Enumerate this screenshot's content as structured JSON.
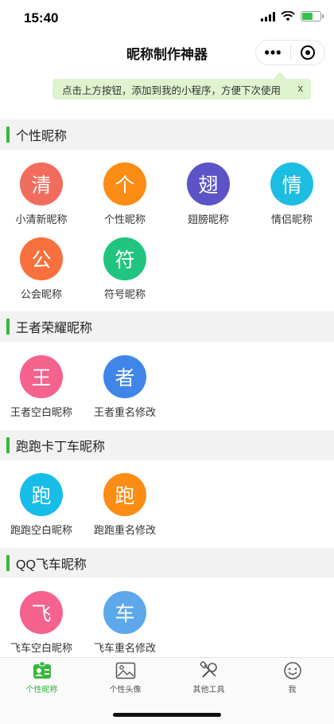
{
  "status": {
    "time": "15:40"
  },
  "nav": {
    "title": "昵称制作神器",
    "more_glyph": "•••"
  },
  "tip": {
    "text": "点击上方按钮，添加到我的小程序，方便下次使用",
    "close": "x"
  },
  "sections": [
    {
      "title": "个性昵称",
      "items": [
        {
          "glyph": "清",
          "label": "小清新昵称",
          "color": "#f26c5e"
        },
        {
          "glyph": "个",
          "label": "个性昵称",
          "color": "#fb8c14"
        },
        {
          "glyph": "翅",
          "label": "翅膀昵称",
          "color": "#5b53c6"
        },
        {
          "glyph": "情",
          "label": "情侣昵称",
          "color": "#1cbde0"
        },
        {
          "glyph": "公",
          "label": "公会昵称",
          "color": "#f7703d"
        },
        {
          "glyph": "符",
          "label": "符号昵称",
          "color": "#21c47e"
        }
      ]
    },
    {
      "title": "王者荣耀昵称",
      "items": [
        {
          "glyph": "王",
          "label": "王者空白昵称",
          "color": "#f4628d"
        },
        {
          "glyph": "者",
          "label": "王者重名修改",
          "color": "#3f86e8"
        }
      ]
    },
    {
      "title": "跑跑卡丁车昵称",
      "items": [
        {
          "glyph": "跑",
          "label": "跑跑空白昵称",
          "color": "#16bde6"
        },
        {
          "glyph": "跑",
          "label": "跑跑重名修改",
          "color": "#fb8c14"
        }
      ]
    },
    {
      "title": "QQ飞车昵称",
      "items": [
        {
          "glyph": "飞",
          "label": "飞车空白昵称",
          "color": "#f4628d"
        },
        {
          "glyph": "车",
          "label": "飞车重名修改",
          "color": "#5ca8ea"
        }
      ]
    }
  ],
  "tabs": [
    {
      "label": "个性昵称",
      "icon": "id-card-icon",
      "active": true
    },
    {
      "label": "个性头像",
      "icon": "image-icon",
      "active": false
    },
    {
      "label": "其他工具",
      "icon": "tools-icon",
      "active": false
    },
    {
      "label": "我",
      "icon": "face-icon",
      "active": false
    }
  ],
  "colors": {
    "accent": "#37b83a",
    "tip_bg": "#dff3cf",
    "section_bg": "#f2f2f2"
  }
}
